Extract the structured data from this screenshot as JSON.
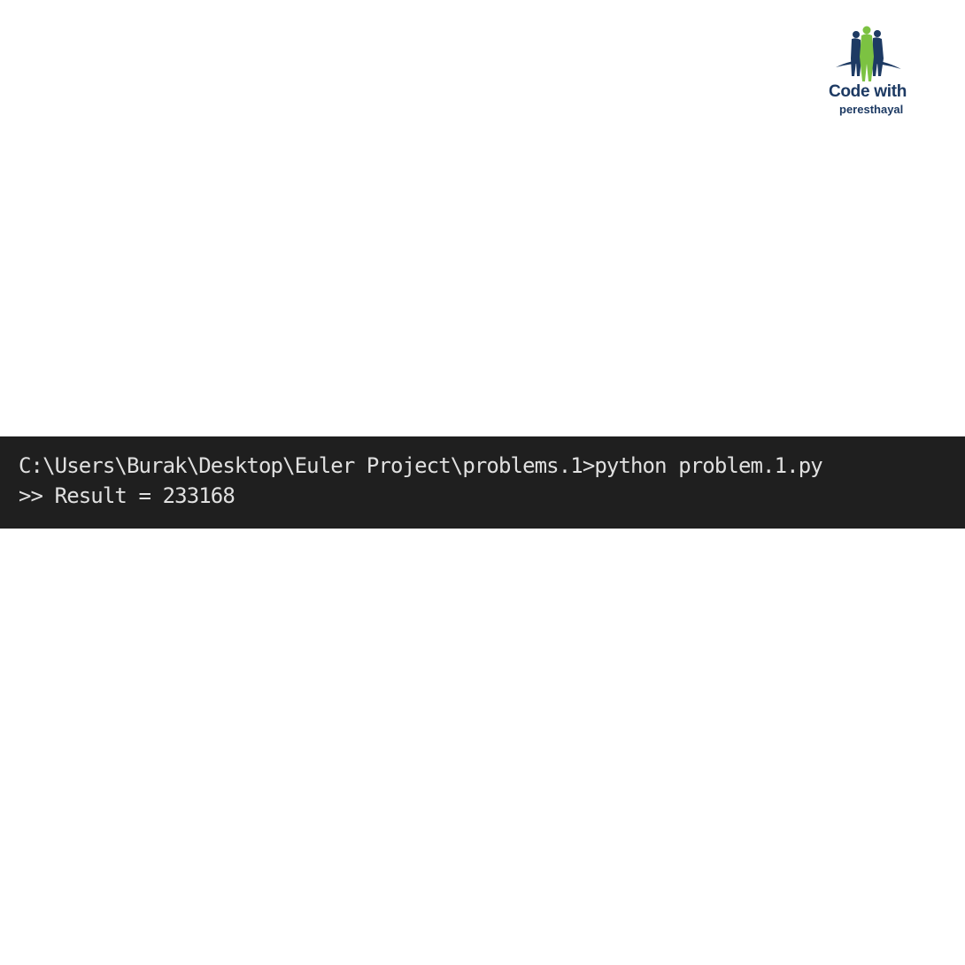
{
  "logo": {
    "title": "Code with",
    "subtitle": "peresthayal",
    "icon": "figures-logo-icon",
    "colors": {
      "navy": "#1d3a63",
      "green": "#7cc242"
    }
  },
  "terminal": {
    "background": "#1f1f1f",
    "text_color": "#e0e0e0",
    "lines": [
      "C:\\Users\\Burak\\Desktop\\Euler Project\\problems.1>python problem.1.py",
      ">> Result = 233168"
    ]
  }
}
